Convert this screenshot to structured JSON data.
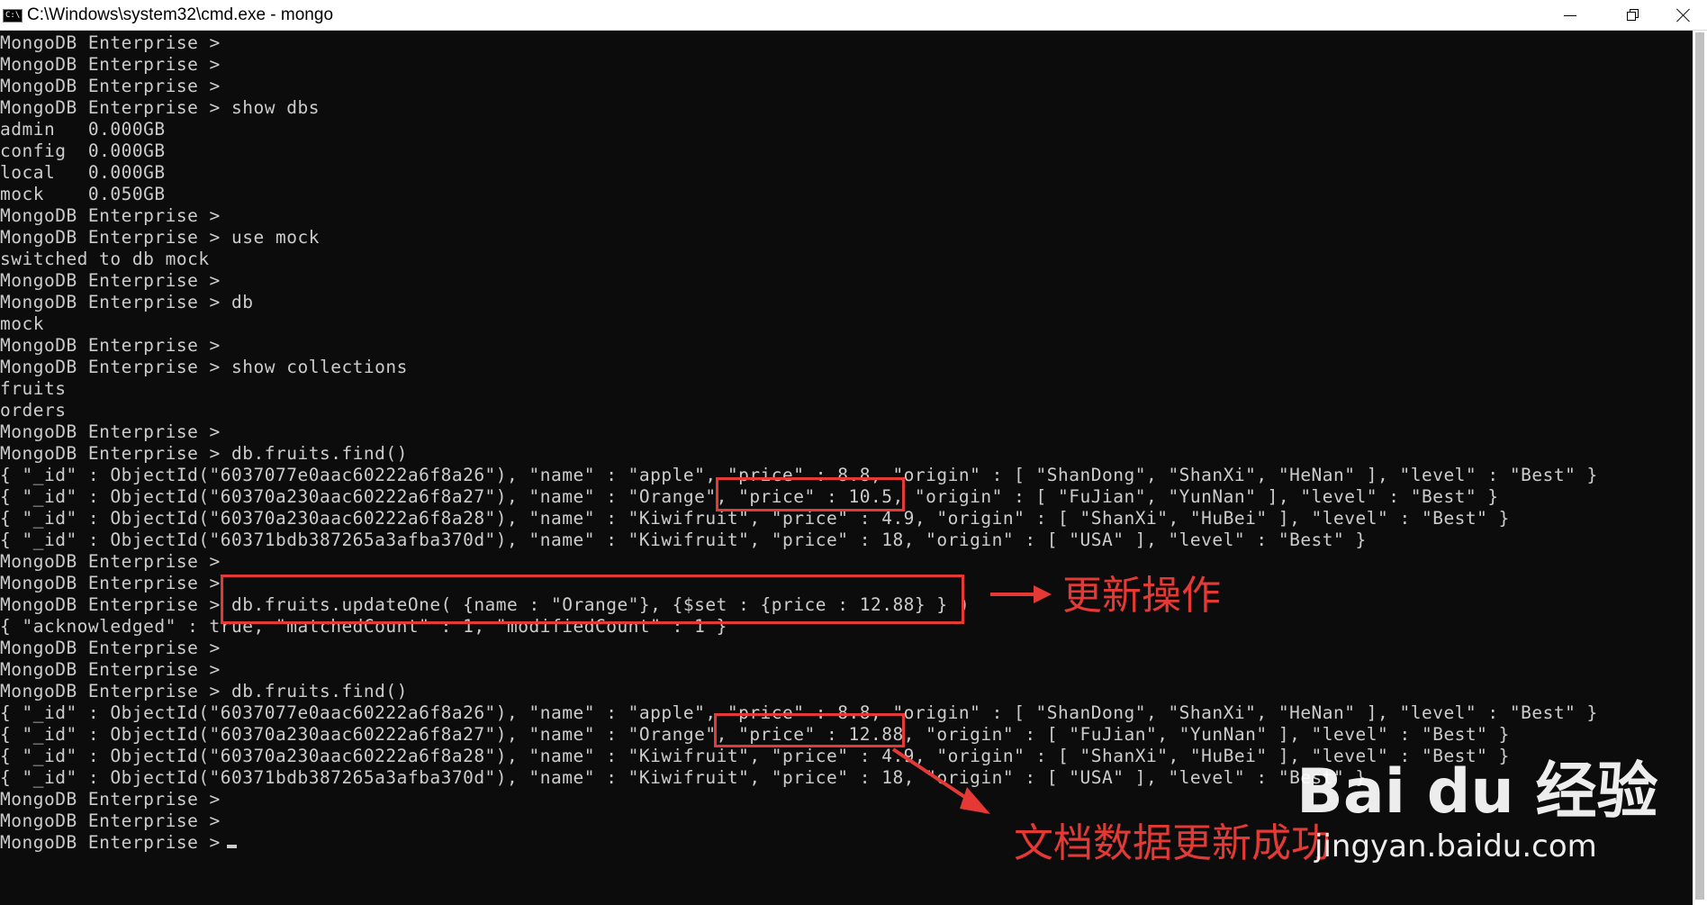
{
  "window": {
    "title": "C:\\Windows\\system32\\cmd.exe - mongo",
    "icon_text": "C:\\",
    "icon": "cmd-icon",
    "buttons": [
      "minimize-icon",
      "maximize-icon",
      "close-icon"
    ]
  },
  "console": {
    "cursor": "▬",
    "lines": [
      "MongoDB Enterprise >",
      "MongoDB Enterprise >",
      "MongoDB Enterprise >",
      "MongoDB Enterprise > show dbs",
      "admin   0.000GB",
      "config  0.000GB",
      "local   0.000GB",
      "mock    0.050GB",
      "MongoDB Enterprise >",
      "MongoDB Enterprise > use mock",
      "switched to db mock",
      "MongoDB Enterprise >",
      "MongoDB Enterprise > db",
      "mock",
      "MongoDB Enterprise >",
      "MongoDB Enterprise > show collections",
      "fruits",
      "orders",
      "MongoDB Enterprise >",
      "MongoDB Enterprise > db.fruits.find()",
      "{ \"_id\" : ObjectId(\"6037077e0aac60222a6f8a26\"), \"name\" : \"apple\", \"price\" : 8.8, \"origin\" : [ \"ShanDong\", \"ShanXi\", \"HeNan\" ], \"level\" : \"Best\" }",
      "{ \"_id\" : ObjectId(\"60370a230aac60222a6f8a27\"), \"name\" : \"Orange\", \"price\" : 10.5, \"origin\" : [ \"FuJian\", \"YunNan\" ], \"level\" : \"Best\" }",
      "{ \"_id\" : ObjectId(\"60370a230aac60222a6f8a28\"), \"name\" : \"Kiwifruit\", \"price\" : 4.9, \"origin\" : [ \"ShanXi\", \"HuBei\" ], \"level\" : \"Best\" }",
      "{ \"_id\" : ObjectId(\"60371bdb387265a3afba370d\"), \"name\" : \"Kiwifruit\", \"price\" : 18, \"origin\" : [ \"USA\" ], \"level\" : \"Best\" }",
      "MongoDB Enterprise >",
      "MongoDB Enterprise >",
      "MongoDB Enterprise > db.fruits.updateOne( {name : \"Orange\"}, {$set : {price : 12.88} } )",
      "{ \"acknowledged\" : true, \"matchedCount\" : 1, \"modifiedCount\" : 1 }",
      "MongoDB Enterprise >",
      "MongoDB Enterprise >",
      "MongoDB Enterprise > db.fruits.find()",
      "{ \"_id\" : ObjectId(\"6037077e0aac60222a6f8a26\"), \"name\" : \"apple\", \"price\" : 8.8, \"origin\" : [ \"ShanDong\", \"ShanXi\", \"HeNan\" ], \"level\" : \"Best\" }",
      "{ \"_id\" : ObjectId(\"60370a230aac60222a6f8a27\"), \"name\" : \"Orange\", \"price\" : 12.88, \"origin\" : [ \"FuJian\", \"YunNan\" ], \"level\" : \"Best\" }",
      "{ \"_id\" : ObjectId(\"60370a230aac60222a6f8a28\"), \"name\" : \"Kiwifruit\", \"price\" : 4.9, \"origin\" : [ \"ShanXi\", \"HuBei\" ], \"level\" : \"Best\" }",
      "{ \"_id\" : ObjectId(\"60371bdb387265a3afba370d\"), \"name\" : \"Kiwifruit\", \"price\" : 18, \"origin\" : [ \"USA\" ], \"level\" : \"Best\" }",
      "MongoDB Enterprise >",
      "MongoDB Enterprise >",
      "MongoDB Enterprise > "
    ]
  },
  "annotations": {
    "update_label": "更新操作",
    "success_label": "文档数据更新成功",
    "highlight_color": "#e53935"
  },
  "watermark": {
    "logo": "Bai du 经验",
    "url": "jingyan.baidu.com"
  }
}
